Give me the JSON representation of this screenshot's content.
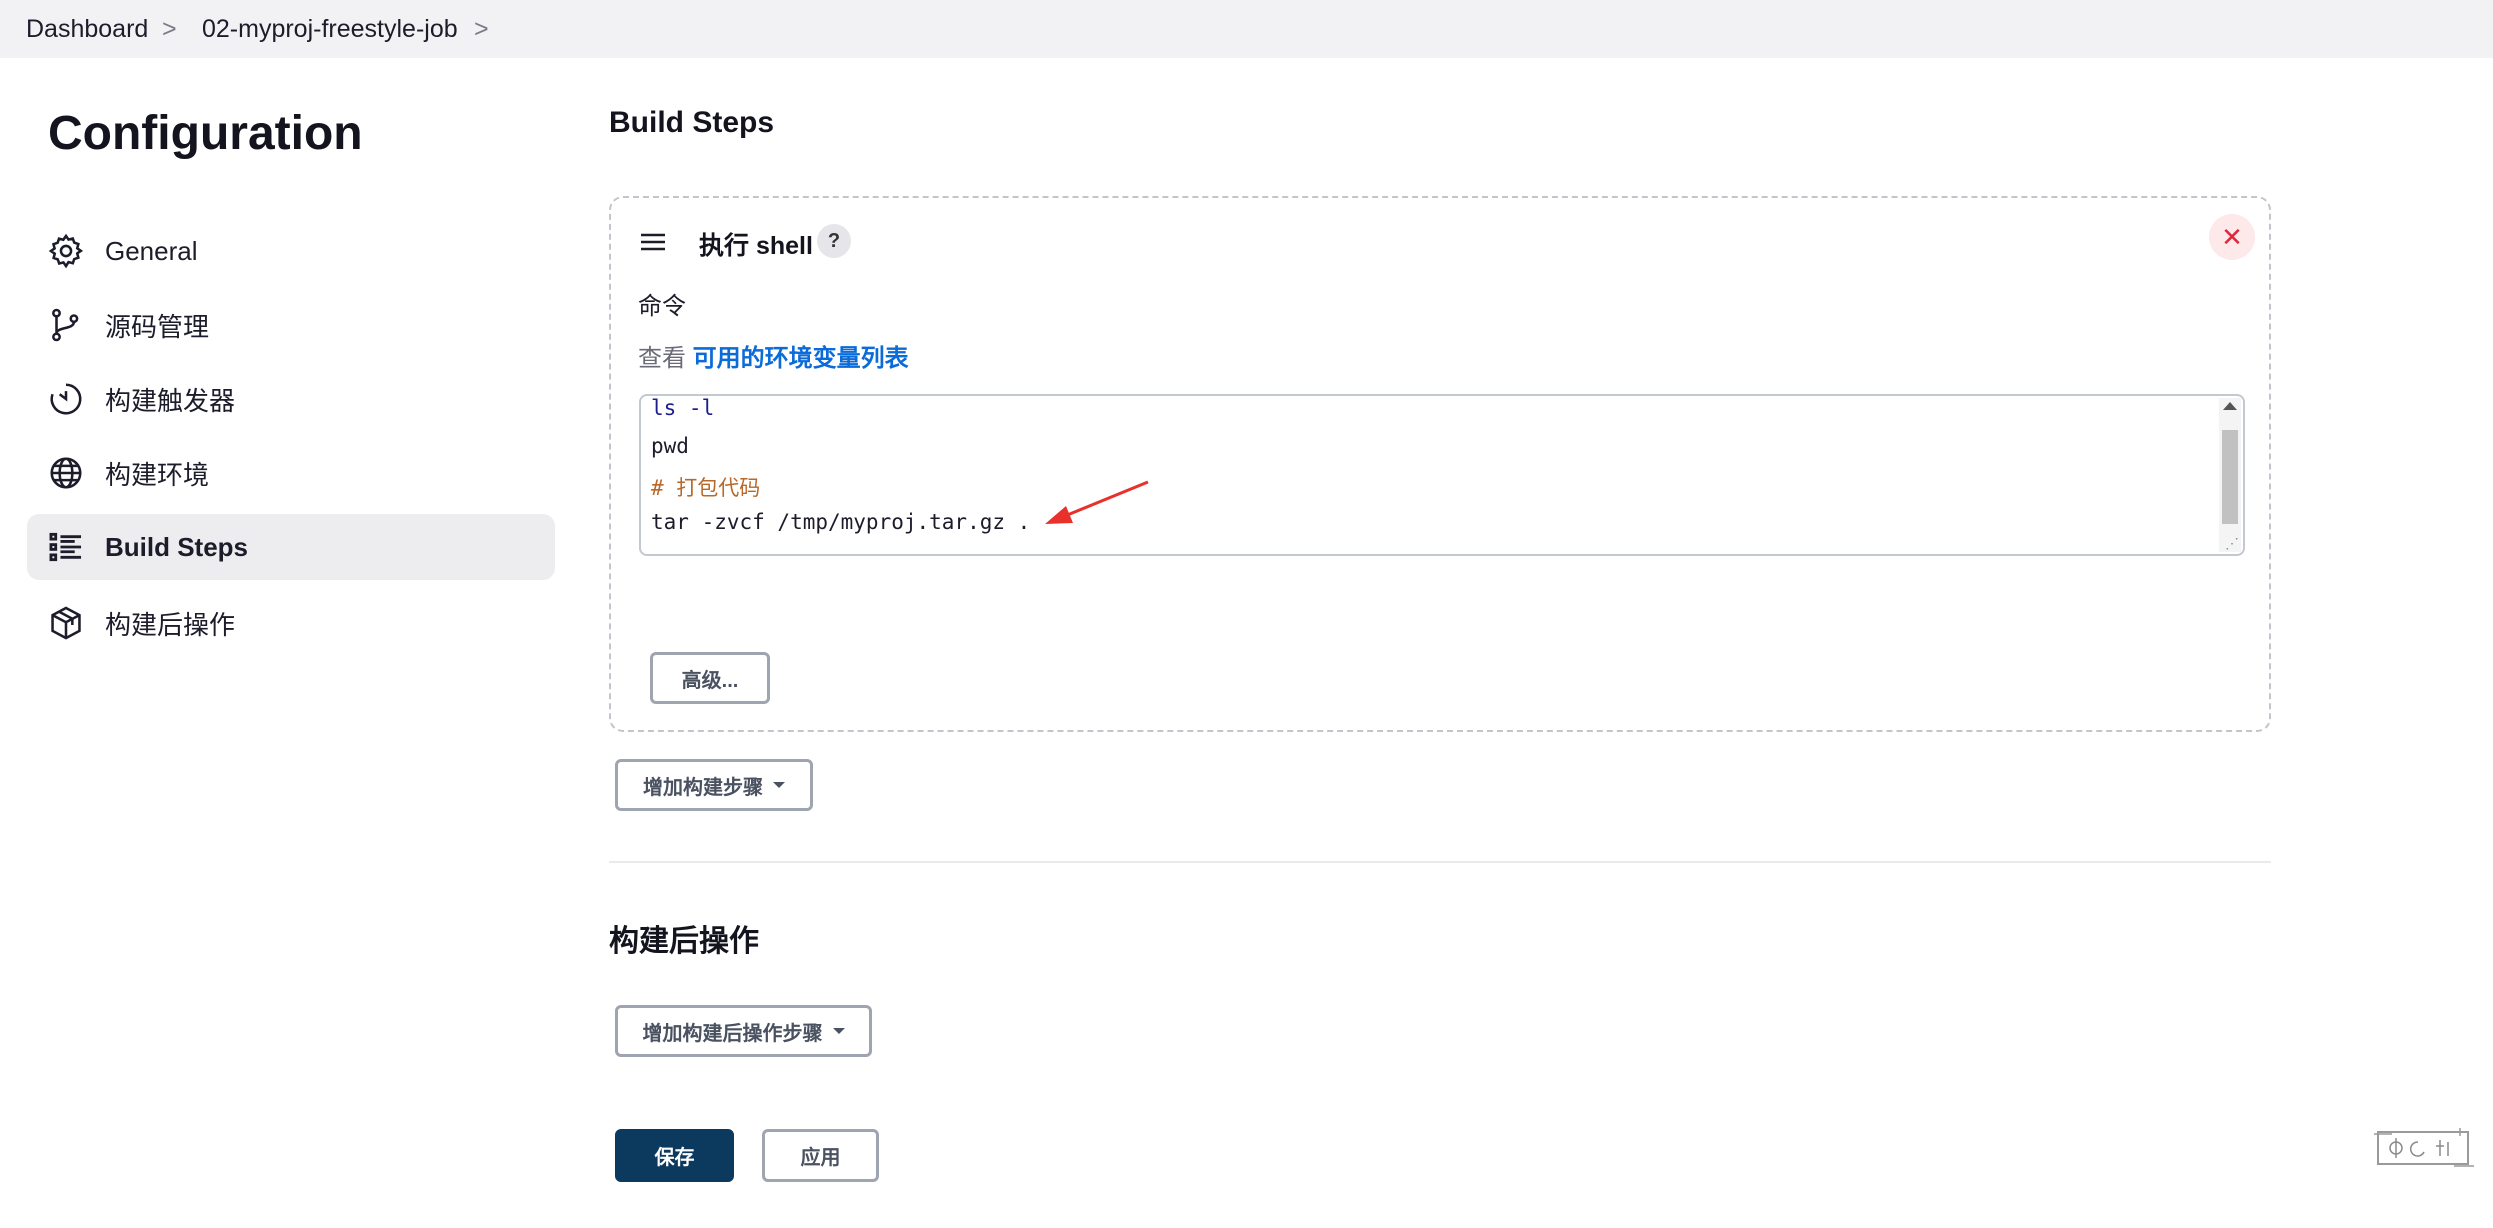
{
  "breadcrumb": {
    "items": [
      "Dashboard",
      "02-myproj-freestyle-job"
    ],
    "separator": ">"
  },
  "sidebar": {
    "title": "Configuration",
    "items": [
      {
        "label": "General",
        "icon": "gear-icon"
      },
      {
        "label": "源码管理",
        "icon": "git-branch-icon"
      },
      {
        "label": "构建触发器",
        "icon": "timer-icon"
      },
      {
        "label": "构建环境",
        "icon": "globe-icon"
      },
      {
        "label": "Build Steps",
        "icon": "list-icon",
        "active": true
      },
      {
        "label": "构建后操作",
        "icon": "package-icon"
      }
    ]
  },
  "main": {
    "build_steps_title": "Build Steps",
    "step": {
      "title": "执行 shell",
      "help": "?",
      "close": "✕",
      "command_label": "命令",
      "env_prefix": "查看",
      "env_link": "可用的环境变量列表",
      "code_lines": [
        "ls -l",
        "pwd",
        "# 打包代码",
        "tar -zvcf /tmp/myproj.tar.gz ."
      ],
      "advanced_button": "高级..."
    },
    "add_step_button": "增加构建步骤",
    "post_build_title": "构建后操作",
    "add_post_step_button": "增加构建后操作步骤",
    "save_button": "保存",
    "apply_button": "应用"
  },
  "colors": {
    "link": "#0b6bd8",
    "primary": "#0b3a5e",
    "active_nav_bg": "#ededf0",
    "close_red": "#e0283c",
    "annotation_arrow": "#e8312a"
  }
}
